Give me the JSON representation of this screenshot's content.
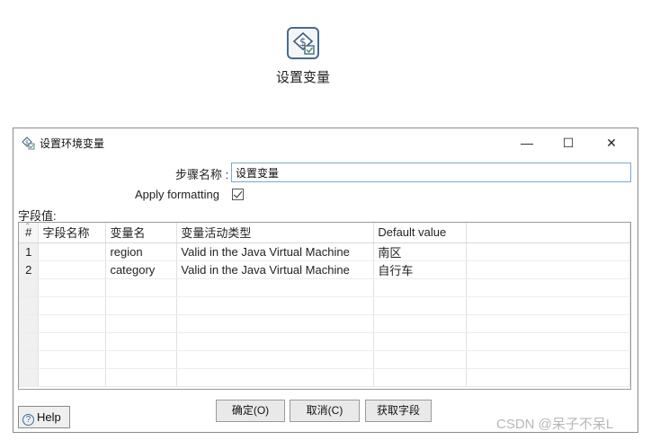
{
  "step": {
    "icon": "set-variable-icon",
    "title": "设置变量"
  },
  "dialog": {
    "title": "设置环境变量",
    "window_icon": "set-variable-icon",
    "controls": {
      "minimize": "—",
      "maximize": "☐",
      "close": "✕"
    },
    "step_name_label": "步骤名称 :",
    "step_name_value": "设置变量",
    "apply_formatting_label": "Apply formatting",
    "apply_formatting_checked": true,
    "fields_label": "字段值:",
    "table": {
      "columns": [
        "#",
        "字段名称",
        "变量名",
        "变量活动类型",
        "Default value",
        ""
      ],
      "rows": [
        [
          "1",
          "",
          "region",
          "Valid in the Java Virtual Machine",
          "南区",
          ""
        ],
        [
          "2",
          "",
          "category",
          "Valid in the Java Virtual Machine",
          "自行车",
          ""
        ],
        [
          "",
          "",
          "",
          "",
          "",
          ""
        ],
        [
          "",
          "",
          "",
          "",
          "",
          ""
        ],
        [
          "",
          "",
          "",
          "",
          "",
          ""
        ],
        [
          "",
          "",
          "",
          "",
          "",
          ""
        ],
        [
          "",
          "",
          "",
          "",
          "",
          ""
        ],
        [
          "",
          "",
          "",
          "",
          "",
          ""
        ]
      ]
    },
    "buttons": {
      "ok": "确定(O)",
      "cancel": "取消(C)",
      "get_fields": "获取字段"
    },
    "help": "Help"
  },
  "watermark": "CSDN @呆子不呆L"
}
